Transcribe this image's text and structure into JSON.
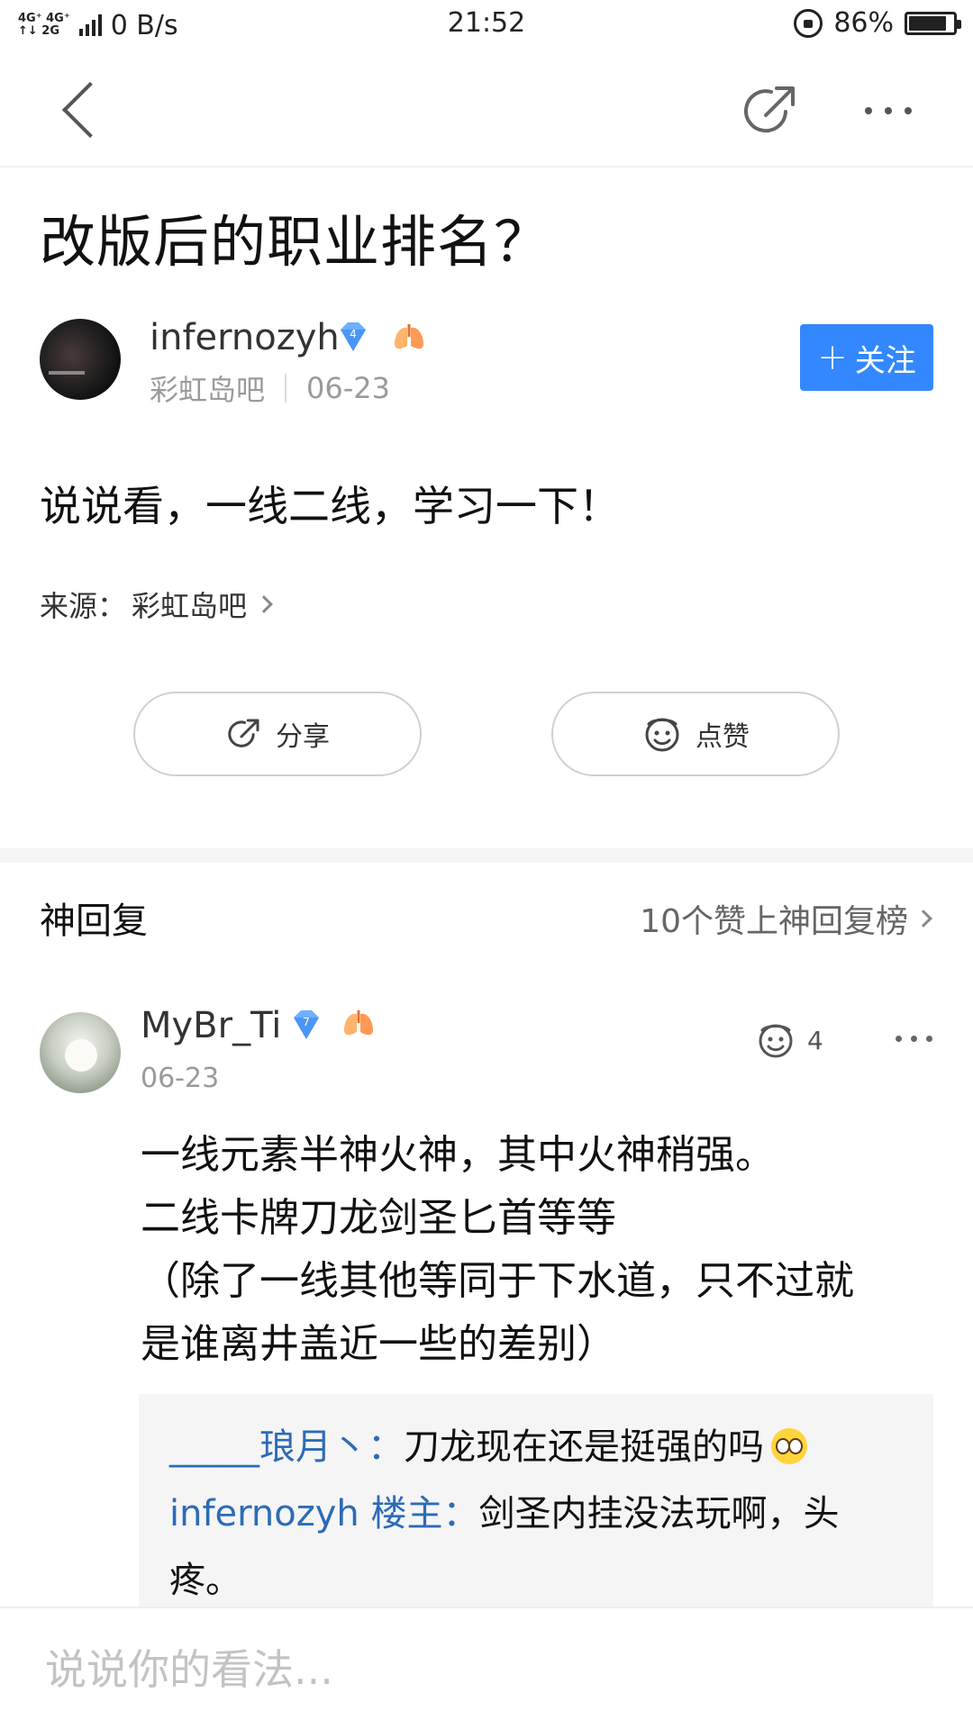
{
  "status_bar": {
    "net_top": "4G⁺ 4G⁺",
    "net_bottom": "↑↓ 2G",
    "speed": "0 B/s",
    "time": "21:52",
    "battery": "86%",
    "battery_level": 0.86
  },
  "nav": {
    "back_icon": "back-chevron-icon",
    "share_icon": "share-arrow-icon",
    "more_icon": "more-dots-icon"
  },
  "post": {
    "title": "改版后的职业排名？",
    "author": "infernozyh",
    "author_level": "4",
    "forum": "彩虹岛吧",
    "date": "06-23",
    "follow_label": "关注",
    "body": "说说看，一线二线，学习一下！",
    "source_label": "来源：",
    "source_name": "彩虹岛吧",
    "share_label": "分享",
    "like_label": "点赞"
  },
  "hot_replies": {
    "title": "神回复",
    "link": "10个赞上神回复榜",
    "reply": {
      "user": "MyBr_Ti",
      "level": "7",
      "date": "06-23",
      "likes": "4",
      "lines": [
        "一线元素半神火神，其中火神稍强。",
        "二线卡牌刀龙剑圣匕首等等",
        "（除了一线其他等同于下水道，只不过就",
        "是谁离井盖近一些的差别）"
      ],
      "sub_replies": [
        {
          "user": "_____琅月丶：",
          "text": "刀龙现在还是挺强的吗"
        },
        {
          "user": "infernozyh 楼主：",
          "text": "剑圣内挂没法玩啊，头",
          "text2": "疼。"
        }
      ]
    }
  },
  "comment_bar": {
    "placeholder": "说说你的看法..."
  },
  "colors": {
    "accent": "#3388ff",
    "link": "#2d6bb7",
    "muted": "#9a9a9a"
  }
}
